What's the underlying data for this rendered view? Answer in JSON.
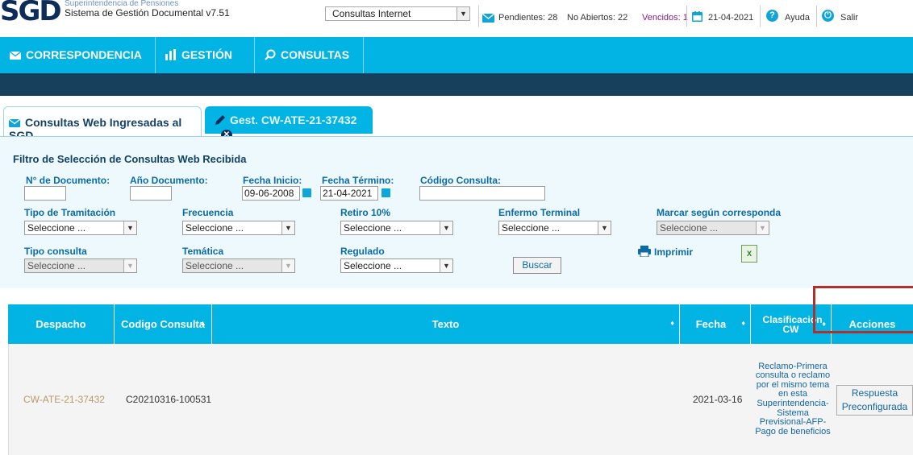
{
  "header": {
    "logo_text": "SGD",
    "org_name": "Superintendencia de Pensiones",
    "system_name": "Sistema de Gestión Documental v7.51",
    "module_select": "Consultas Internet",
    "pendientes": "Pendientes: 28",
    "no_abiertos": "No Abiertos: 22",
    "vencidos": "Vencidos: 1",
    "date": "21-04-2021",
    "help": "Ayuda",
    "logout": "Salir"
  },
  "nav": {
    "items": [
      "CORRESPONDENCIA",
      "GESTIÓN",
      "CONSULTAS"
    ]
  },
  "tabs": {
    "tab1": "Consultas Web Ingresadas al SGD",
    "tab2": "Gest. CW-ATE-21-37432"
  },
  "filter": {
    "title": "Filtro de Selección de Consultas Web Recibida",
    "doc_num_label": "N° de Documento:",
    "doc_num_value": "",
    "year_label": "Año Documento:",
    "year_value": "",
    "start_label": "Fecha Inicio:",
    "start_value": "09-06-2008",
    "end_label": "Fecha Término:",
    "end_value": "21-04-2021",
    "code_label": "Código Consulta:",
    "code_value": "",
    "tipo_tram_label": "Tipo de Tramitación",
    "frecuencia_label": "Frecuencia",
    "retiro_label": "Retiro 10%",
    "enfermo_label": "Enfermo Terminal",
    "marcar_label": "Marcar según corresponda",
    "tipo_consulta_label": "Tipo consulta",
    "tematica_label": "Temática",
    "regulado_label": "Regulado",
    "select_placeholder": "Seleccione ...",
    "search_button": "Buscar",
    "print_label": "Imprimir"
  },
  "table": {
    "headers": [
      "Despacho",
      "Codigo Consulta",
      "Texto",
      "Fecha",
      "Clasificacion CW",
      "Acciones"
    ],
    "rows": [
      {
        "despacho": "CW-ATE-21-37432",
        "codigo": "C20210316-100531",
        "texto": "",
        "fecha": "2021-03-16",
        "clasificacion": "Reclamo-Primera consulta o reclamo por el mismo tema en esta Superintendencia-Sistema Previsional-AFP-Pago de beneficios",
        "accion_line1": "Respuesta",
        "accion_line2": "Preconfigurada"
      }
    ]
  },
  "colors": {
    "accent": "#01b4e4",
    "dark_band": "#16405c",
    "label_blue": "#0c6aa8",
    "vencidos": "#8a1a8a",
    "highlight_box": "#b0302a"
  },
  "icons": {
    "mail": "envelope-icon",
    "calendar": "calendar-icon",
    "help": "question-icon",
    "power": "power-icon",
    "chart": "bar-chart-icon",
    "search": "search-icon",
    "pen": "pen-icon",
    "close": "close-icon",
    "print": "printer-icon",
    "excel": "excel-icon"
  }
}
